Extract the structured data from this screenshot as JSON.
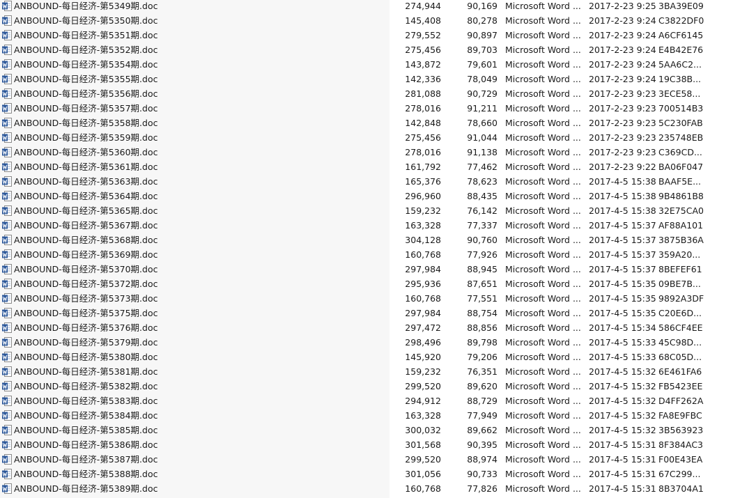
{
  "file_list": {
    "icon": "word-document-icon",
    "rows": [
      {
        "name": "ANBOUND-每日经济-第5349期.doc",
        "size": "274,944",
        "packed": "90,169",
        "type": "Microsoft Word ...",
        "modified": "2017-2-23 9:25",
        "crc": "3BA39E09"
      },
      {
        "name": "ANBOUND-每日经济-第5350期.doc",
        "size": "145,408",
        "packed": "80,278",
        "type": "Microsoft Word ...",
        "modified": "2017-2-23 9:24",
        "crc": "C3822DF0"
      },
      {
        "name": "ANBOUND-每日经济-第5351期.doc",
        "size": "279,552",
        "packed": "90,897",
        "type": "Microsoft Word ...",
        "modified": "2017-2-23 9:24",
        "crc": "A6CF6145"
      },
      {
        "name": "ANBOUND-每日经济-第5352期.doc",
        "size": "275,456",
        "packed": "89,703",
        "type": "Microsoft Word ...",
        "modified": "2017-2-23 9:24",
        "crc": "E4B42E76"
      },
      {
        "name": "ANBOUND-每日经济-第5354期.doc",
        "size": "143,872",
        "packed": "79,601",
        "type": "Microsoft Word ...",
        "modified": "2017-2-23 9:24",
        "crc": "5AA6C2..."
      },
      {
        "name": "ANBOUND-每日经济-第5355期.doc",
        "size": "142,336",
        "packed": "78,049",
        "type": "Microsoft Word ...",
        "modified": "2017-2-23 9:24",
        "crc": "19C38B..."
      },
      {
        "name": "ANBOUND-每日经济-第5356期.doc",
        "size": "281,088",
        "packed": "90,729",
        "type": "Microsoft Word ...",
        "modified": "2017-2-23 9:23",
        "crc": "3ECE58..."
      },
      {
        "name": "ANBOUND-每日经济-第5357期.doc",
        "size": "278,016",
        "packed": "91,211",
        "type": "Microsoft Word ...",
        "modified": "2017-2-23 9:23",
        "crc": "700514B3"
      },
      {
        "name": "ANBOUND-每日经济-第5358期.doc",
        "size": "142,848",
        "packed": "78,660",
        "type": "Microsoft Word ...",
        "modified": "2017-2-23 9:23",
        "crc": "5C230FAB"
      },
      {
        "name": "ANBOUND-每日经济-第5359期.doc",
        "size": "275,456",
        "packed": "91,044",
        "type": "Microsoft Word ...",
        "modified": "2017-2-23 9:23",
        "crc": "235748EB"
      },
      {
        "name": "ANBOUND-每日经济-第5360期.doc",
        "size": "278,016",
        "packed": "91,138",
        "type": "Microsoft Word ...",
        "modified": "2017-2-23 9:23",
        "crc": "C369CD..."
      },
      {
        "name": "ANBOUND-每日经济-第5361期.doc",
        "size": "161,792",
        "packed": "77,462",
        "type": "Microsoft Word ...",
        "modified": "2017-2-23 9:22",
        "crc": "BA06F047"
      },
      {
        "name": "ANBOUND-每日经济-第5363期.doc",
        "size": "165,376",
        "packed": "78,623",
        "type": "Microsoft Word ...",
        "modified": "2017-4-5 15:38",
        "crc": "BAAF5E..."
      },
      {
        "name": "ANBOUND-每日经济-第5364期.doc",
        "size": "296,960",
        "packed": "88,435",
        "type": "Microsoft Word ...",
        "modified": "2017-4-5 15:38",
        "crc": "9B4861B8"
      },
      {
        "name": "ANBOUND-每日经济-第5365期.doc",
        "size": "159,232",
        "packed": "76,142",
        "type": "Microsoft Word ...",
        "modified": "2017-4-5 15:38",
        "crc": "32E75CA0"
      },
      {
        "name": "ANBOUND-每日经济-第5367期.doc",
        "size": "163,328",
        "packed": "77,337",
        "type": "Microsoft Word ...",
        "modified": "2017-4-5 15:37",
        "crc": "AF88A101"
      },
      {
        "name": "ANBOUND-每日经济-第5368期.doc",
        "size": "304,128",
        "packed": "90,760",
        "type": "Microsoft Word ...",
        "modified": "2017-4-5 15:37",
        "crc": "3875B36A"
      },
      {
        "name": "ANBOUND-每日经济-第5369期.doc",
        "size": "160,768",
        "packed": "77,926",
        "type": "Microsoft Word ...",
        "modified": "2017-4-5 15:37",
        "crc": "359A20..."
      },
      {
        "name": "ANBOUND-每日经济-第5370期.doc",
        "size": "297,984",
        "packed": "88,945",
        "type": "Microsoft Word ...",
        "modified": "2017-4-5 15:37",
        "crc": "8BEFEF61"
      },
      {
        "name": "ANBOUND-每日经济-第5372期.doc",
        "size": "295,936",
        "packed": "87,651",
        "type": "Microsoft Word ...",
        "modified": "2017-4-5 15:35",
        "crc": "09BE7B..."
      },
      {
        "name": "ANBOUND-每日经济-第5373期.doc",
        "size": "160,768",
        "packed": "77,551",
        "type": "Microsoft Word ...",
        "modified": "2017-4-5 15:35",
        "crc": "9892A3DF"
      },
      {
        "name": "ANBOUND-每日经济-第5375期.doc",
        "size": "297,984",
        "packed": "88,754",
        "type": "Microsoft Word ...",
        "modified": "2017-4-5 15:35",
        "crc": "C20E6D..."
      },
      {
        "name": "ANBOUND-每日经济-第5376期.doc",
        "size": "297,472",
        "packed": "88,856",
        "type": "Microsoft Word ...",
        "modified": "2017-4-5 15:34",
        "crc": "586CF4EE"
      },
      {
        "name": "ANBOUND-每日经济-第5379期.doc",
        "size": "298,496",
        "packed": "89,798",
        "type": "Microsoft Word ...",
        "modified": "2017-4-5 15:33",
        "crc": "45C98D..."
      },
      {
        "name": "ANBOUND-每日经济-第5380期.doc",
        "size": "145,920",
        "packed": "79,206",
        "type": "Microsoft Word ...",
        "modified": "2017-4-5 15:33",
        "crc": "68C05D..."
      },
      {
        "name": "ANBOUND-每日经济-第5381期.doc",
        "size": "159,232",
        "packed": "76,351",
        "type": "Microsoft Word ...",
        "modified": "2017-4-5 15:32",
        "crc": "6E461FA6"
      },
      {
        "name": "ANBOUND-每日经济-第5382期.doc",
        "size": "299,520",
        "packed": "89,620",
        "type": "Microsoft Word ...",
        "modified": "2017-4-5 15:32",
        "crc": "FB5423EE"
      },
      {
        "name": "ANBOUND-每日经济-第5383期.doc",
        "size": "294,912",
        "packed": "88,729",
        "type": "Microsoft Word ...",
        "modified": "2017-4-5 15:32",
        "crc": "D4FF262A"
      },
      {
        "name": "ANBOUND-每日经济-第5384期.doc",
        "size": "163,328",
        "packed": "77,949",
        "type": "Microsoft Word ...",
        "modified": "2017-4-5 15:32",
        "crc": "FA8E9FBC"
      },
      {
        "name": "ANBOUND-每日经济-第5385期.doc",
        "size": "300,032",
        "packed": "89,662",
        "type": "Microsoft Word ...",
        "modified": "2017-4-5 15:32",
        "crc": "3B563923"
      },
      {
        "name": "ANBOUND-每日经济-第5386期.doc",
        "size": "301,568",
        "packed": "90,395",
        "type": "Microsoft Word ...",
        "modified": "2017-4-5 15:31",
        "crc": "8F384AC3"
      },
      {
        "name": "ANBOUND-每日经济-第5387期.doc",
        "size": "299,520",
        "packed": "88,974",
        "type": "Microsoft Word ...",
        "modified": "2017-4-5 15:31",
        "crc": "F00E43EA"
      },
      {
        "name": "ANBOUND-每日经济-第5388期.doc",
        "size": "301,056",
        "packed": "90,733",
        "type": "Microsoft Word ...",
        "modified": "2017-4-5 15:31",
        "crc": "67C299..."
      },
      {
        "name": "ANBOUND-每日经济-第5389期.doc",
        "size": "160,768",
        "packed": "77,826",
        "type": "Microsoft Word ...",
        "modified": "2017-4-5 15:31",
        "crc": "8B3704A1"
      }
    ]
  }
}
